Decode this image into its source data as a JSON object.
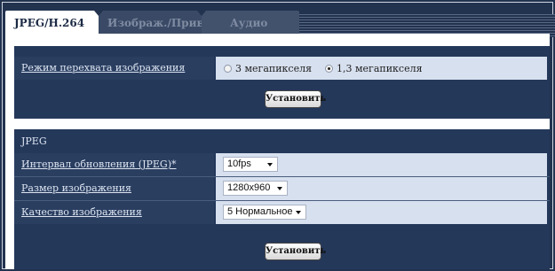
{
  "tabs": [
    {
      "label": "JPEG/H.264"
    },
    {
      "label": "Изображ./Приваси"
    },
    {
      "label": "Аудио"
    }
  ],
  "capture_mode": {
    "label": "Режим перехвата изображения",
    "options": [
      {
        "label": "3 мегапикселя",
        "checked": false
      },
      {
        "label": "1,3 мегапикселя",
        "checked": true
      }
    ]
  },
  "buttons": {
    "set_label_1": "Установить",
    "set_label_2": "Установить"
  },
  "jpeg_section": {
    "title": "JPEG",
    "rows": [
      {
        "label": "Интервал обновления (JPEG)*",
        "value": "10fps"
      },
      {
        "label": "Размер изображения",
        "value": "1280x960"
      },
      {
        "label": "Качество изображения",
        "value": "5 Нормальное"
      }
    ]
  }
}
